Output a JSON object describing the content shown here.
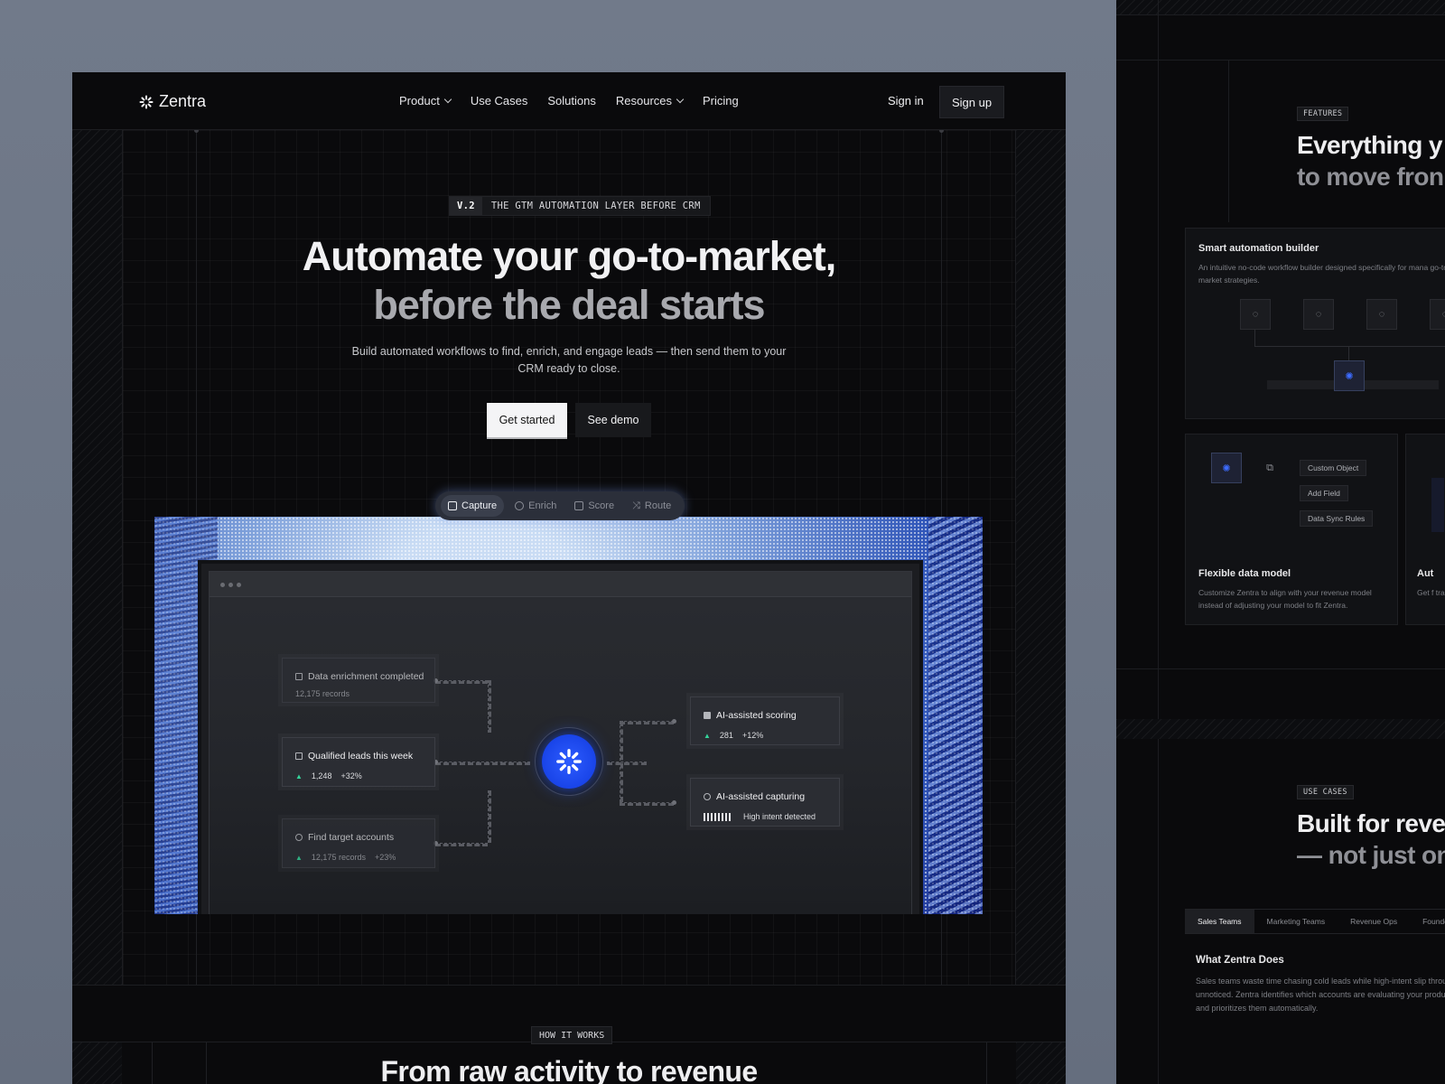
{
  "nav": {
    "brand": "Zentra",
    "links": [
      "Product",
      "Use Cases",
      "Solutions",
      "Resources",
      "Pricing"
    ],
    "sign_in": "Sign in",
    "sign_up": "Sign up"
  },
  "hero": {
    "badge_version": "V.2",
    "badge_text": "THE GTM AUTOMATION LAYER BEFORE CRM",
    "title_line1": "Automate your go-to-market,",
    "title_line2": "before the deal starts",
    "subtitle": "Build automated workflows to find, enrich, and engage leads — then send them to your CRM ready to close.",
    "cta_primary": "Get started",
    "cta_secondary": "See demo"
  },
  "preview": {
    "tabs": [
      "Capture",
      "Enrich",
      "Score",
      "Route"
    ],
    "active_tab": "Capture",
    "cards": {
      "enrichment": {
        "title": "Data enrichment completed",
        "meta": "12,175 records"
      },
      "qualified": {
        "title": "Qualified leads this week",
        "value": "1,248",
        "delta": "+32%"
      },
      "target": {
        "title": "Find target accounts",
        "value": "12,175 records",
        "delta": "+23%"
      },
      "scoring": {
        "title": "AI-assisted scoring",
        "value": "281",
        "delta": "+12%"
      },
      "capturing": {
        "title": "AI-assisted capturing",
        "status": "High intent detected"
      }
    }
  },
  "how": {
    "badge": "HOW IT WORKS",
    "title": "From raw activity to revenue"
  },
  "features": {
    "badge": "FEATURES",
    "title_line1": "Everything y",
    "title_line2": "to move fron",
    "card1": {
      "title": "Smart automation builder",
      "desc": "An intuitive no-code workflow builder designed specifically for mana go-to-market strategies."
    },
    "card2": {
      "title": "Flexible data model",
      "desc": "Customize Zentra to align with your revenue model instead of adjusting your model to fit Zentra.",
      "chips": [
        "Custom Object",
        "Add Field",
        "Data Sync Rules"
      ]
    },
    "card3": {
      "title": "Aut",
      "desc": "Get f trans"
    }
  },
  "use_cases": {
    "badge": "USE CASES",
    "title_line1": "Built for reve",
    "title_line2": "— not just on",
    "tabs": [
      "Sales Teams",
      "Marketing Teams",
      "Revenue Ops",
      "Founder"
    ],
    "active_tab": "Sales Teams",
    "section_title": "What Zentra Does",
    "section_desc": "Sales teams waste time chasing cold leads while high-intent slip through unnoticed. Zentra identifies which accounts are evaluating your product and prioritizes them automatically."
  },
  "colors": {
    "accent_blue": "#1f4bff",
    "positive_green": "#34d39a",
    "background": "#0a0a0c"
  }
}
